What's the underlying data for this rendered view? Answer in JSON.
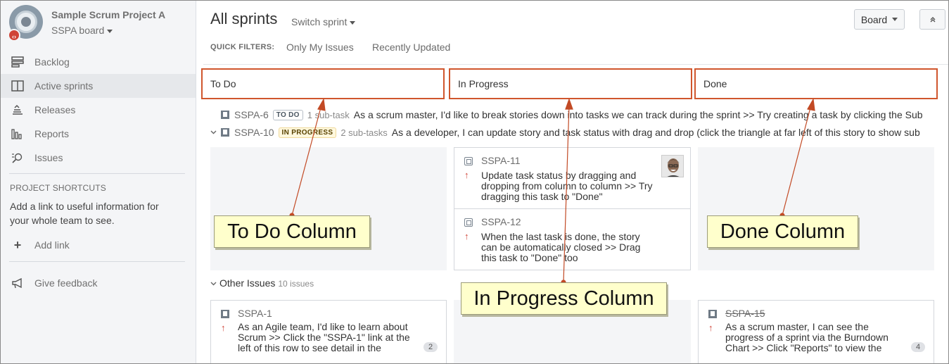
{
  "project": {
    "name": "Sample Scrum Project A",
    "board": "SSPA board",
    "badge": "‹›"
  },
  "nav": [
    {
      "label": "Backlog",
      "icon": "backlog-icon",
      "active": false
    },
    {
      "label": "Active sprints",
      "icon": "active-sprints-icon",
      "active": true
    },
    {
      "label": "Releases",
      "icon": "releases-icon",
      "active": false
    },
    {
      "label": "Reports",
      "icon": "reports-icon",
      "active": false
    },
    {
      "label": "Issues",
      "icon": "issues-icon",
      "active": false
    }
  ],
  "shortcuts": {
    "title": "PROJECT SHORTCUTS",
    "text": "Add a link to useful information for your whole team to see.",
    "add_link": "Add link",
    "feedback": "Give feedback"
  },
  "header": {
    "title": "All sprints",
    "switch": "Switch sprint",
    "board_btn": "Board",
    "collapse_icon": "collapse-up-icon",
    "quick_filters_label": "QUICK FILTERS:",
    "quick_filters": [
      "Only My Issues",
      "Recently Updated"
    ]
  },
  "columns": [
    "To Do",
    "In Progress",
    "Done"
  ],
  "swimlanes": [
    {
      "key": "SSPA-6",
      "status": "TO DO",
      "subtasks": "1 sub-task",
      "summary": "As a scrum master, I'd like to break stories down into tasks we can track during the sprint >> Try creating a task by clicking the Sub"
    },
    {
      "key": "SSPA-10",
      "status": "IN PROGRESS",
      "subtasks": "2 sub-tasks",
      "summary": "As a developer, I can update story and task status with drag and drop (click the triangle at far left of this story to show sub"
    }
  ],
  "cards": {
    "sspa11": {
      "key": "SSPA-11",
      "summary": [
        "Update task status by dragging and",
        "dropping from column to column >> Try",
        "dragging this task to \"Done\""
      ]
    },
    "sspa12": {
      "key": "SSPA-12",
      "summary": [
        "When the last task is done, the story",
        "can be automatically closed >> Drag",
        "this task to \"Done\" too"
      ]
    },
    "sspa1": {
      "key": "SSPA-1",
      "summary": [
        "As an Agile team, I'd like to learn about",
        "Scrum >> Click the \"SSPA-1\" link at the",
        "left of this row to see detail in the"
      ],
      "count": "2"
    },
    "sspa15": {
      "key": "SSPA-15",
      "summary": [
        "As a scrum master, I can see the",
        "progress of a sprint via the Burndown",
        "Chart >> Click \"Reports\" to view the"
      ],
      "count": "4"
    }
  },
  "other_issues": {
    "label": "Other Issues",
    "count": "10 issues"
  },
  "callouts": {
    "todo": "To Do Column",
    "progress": "In Progress Column",
    "done": "Done Column"
  },
  "colors": {
    "highlight": "#d0562d",
    "callout_bg": "#ffffcc",
    "priority": "#d04437"
  }
}
